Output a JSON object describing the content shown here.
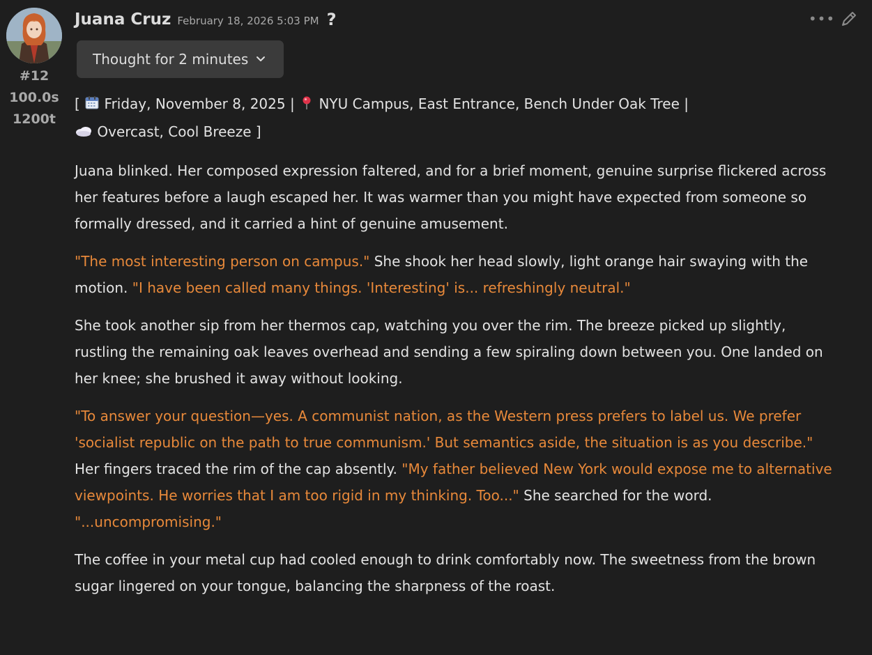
{
  "message": {
    "author": "Juana Cruz",
    "timestamp": "February 18, 2026 5:03 PM",
    "help_glyph": "?",
    "avatar_icon": "character-portrait-avatar",
    "stats": {
      "index": "#12",
      "duration": "100.0s",
      "tokens": "1200t"
    },
    "actions": {
      "more_glyph": "•••",
      "more_icon": "ellipsis-icon",
      "edit_icon": "pencil-icon"
    },
    "thought_toggle": {
      "label": "Thought for 2 minutes",
      "icon": "chevron-down-icon"
    },
    "header_line": {
      "open_bracket": "[",
      "date_icon": "calendar-icon",
      "date": "Friday, November 8, 2025",
      "sep1": "|",
      "location_icon": "pin-icon",
      "location": "NYU Campus, East Entrance, Bench Under Oak Tree",
      "sep2": "|",
      "weather_icon": "cloud-icon",
      "weather": "Overcast, Cool Breeze",
      "close_bracket": "]"
    },
    "paragraphs": {
      "p1": "Juana blinked. Her composed expression faltered, and for a brief moment, genuine surprise flickered across her features before a laugh escaped her. It was warmer than you might have expected from someone so formally dressed, and it carried a hint of genuine amusement.",
      "p2_q1": "\"The most interesting person on campus.\"",
      "p2_t1": "She shook her head slowly, light orange hair swaying with the motion.",
      "p2_q2": "\"I have been called many things. 'Interesting' is... refreshingly neutral.\"",
      "p3": "She took another sip from her thermos cap, watching you over the rim. The breeze picked up slightly, rustling the remaining oak leaves overhead and sending a few spiraling down between you. One landed on her knee; she brushed it away without looking.",
      "p4_q1": "\"To answer your question—yes. A communist nation, as the Western press prefers to label us. We prefer 'socialist republic on the path to true communism.' But semantics aside, the situation is as you describe.\"",
      "p4_t1": "Her fingers traced the rim of the cap absently.",
      "p4_q2": "\"My father believed New York would expose me to alternative viewpoints. He worries that I am too rigid in my thinking. Too...\"",
      "p4_t2": "She searched for the word.",
      "p4_q3": "\"...uncompromising.\"",
      "p5": "The coffee in your metal cup had cooled enough to drink comfortably now. The sweetness from the brown sugar lingered on your tongue, balancing the sharpness of the roast."
    },
    "colors": {
      "background": "#1e1e1e",
      "text": "#e3e3e3",
      "quote": "#e8893a",
      "muted": "#a9a9a9",
      "button_bg": "#3b3b3b"
    }
  }
}
